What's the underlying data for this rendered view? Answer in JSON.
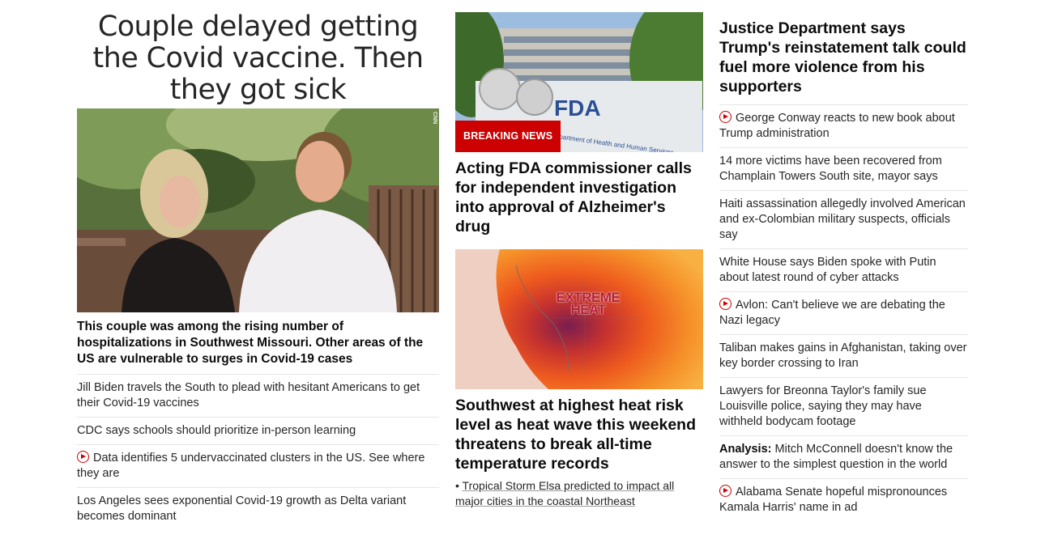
{
  "col1": {
    "headline": "Couple delayed getting the Covid vaccine. Then they got sick",
    "photo_credit": "CNN",
    "sub_headline": "This couple was among the rising number of hospitalizations in Southwest Missouri. Other areas of the US are vulnerable to surges in Covid-19 cases",
    "items": [
      {
        "text": "Jill Biden travels the South to plead with hesitant Americans to get their Covid-19 vaccines",
        "video": false
      },
      {
        "text": "CDC says schools should prioritize in-person learning",
        "video": false
      },
      {
        "text": "Data identifies 5 undervaccinated clusters in the US. See where they are",
        "video": true
      },
      {
        "text": "Los Angeles sees exponential Covid-19 growth as Delta variant becomes dominant",
        "video": false
      }
    ]
  },
  "col2": {
    "badge": "BREAKING NEWS",
    "fda_sign": "FDA",
    "fda_sign_sub": "Department of Health and Human Services",
    "headline1": "Acting FDA commissioner calls for independent investigation into approval of Alzheimer's drug",
    "map_label_1": "EXTREME",
    "map_label_2": "HEAT",
    "headline2": "Southwest at highest heat risk level as heat wave this weekend threatens to break all-time temperature records",
    "related_bullet": "•",
    "related": "Tropical Storm Elsa predicted to impact all major cities in the coastal Northeast"
  },
  "col3": {
    "headline": "Justice Department says Trump's reinstatement talk could fuel more violence from his supporters",
    "items": [
      {
        "text": "George Conway reacts to new book about Trump administration",
        "video": true,
        "label": ""
      },
      {
        "text": "14 more victims have been recovered from Champlain Towers South site, mayor says",
        "video": false,
        "label": ""
      },
      {
        "text": "Haiti assassination allegedly involved American and ex-Colombian military suspects, officials say",
        "video": false,
        "label": ""
      },
      {
        "text": "White House says Biden spoke with Putin about latest round of cyber attacks",
        "video": false,
        "label": ""
      },
      {
        "text": "Avlon: Can't believe we are debating the Nazi legacy",
        "video": true,
        "label": ""
      },
      {
        "text": "Taliban makes gains in Afghanistan, taking over key border crossing to Iran",
        "video": false,
        "label": ""
      },
      {
        "text": "Lawyers for Breonna Taylor's family sue Louisville police, saying they may have withheld bodycam footage",
        "video": false,
        "label": ""
      },
      {
        "text": "Mitch McConnell doesn't know the answer to the simplest question in the world",
        "video": false,
        "label": "Analysis:"
      },
      {
        "text": "Alabama Senate hopeful mispronounces Kamala Harris' name in ad",
        "video": true,
        "label": ""
      }
    ]
  },
  "colors": {
    "accent": "#cc0000",
    "text": "#0c0c0c",
    "divider": "#e6e6e6"
  },
  "icons": {
    "video": "play-circle-icon"
  }
}
